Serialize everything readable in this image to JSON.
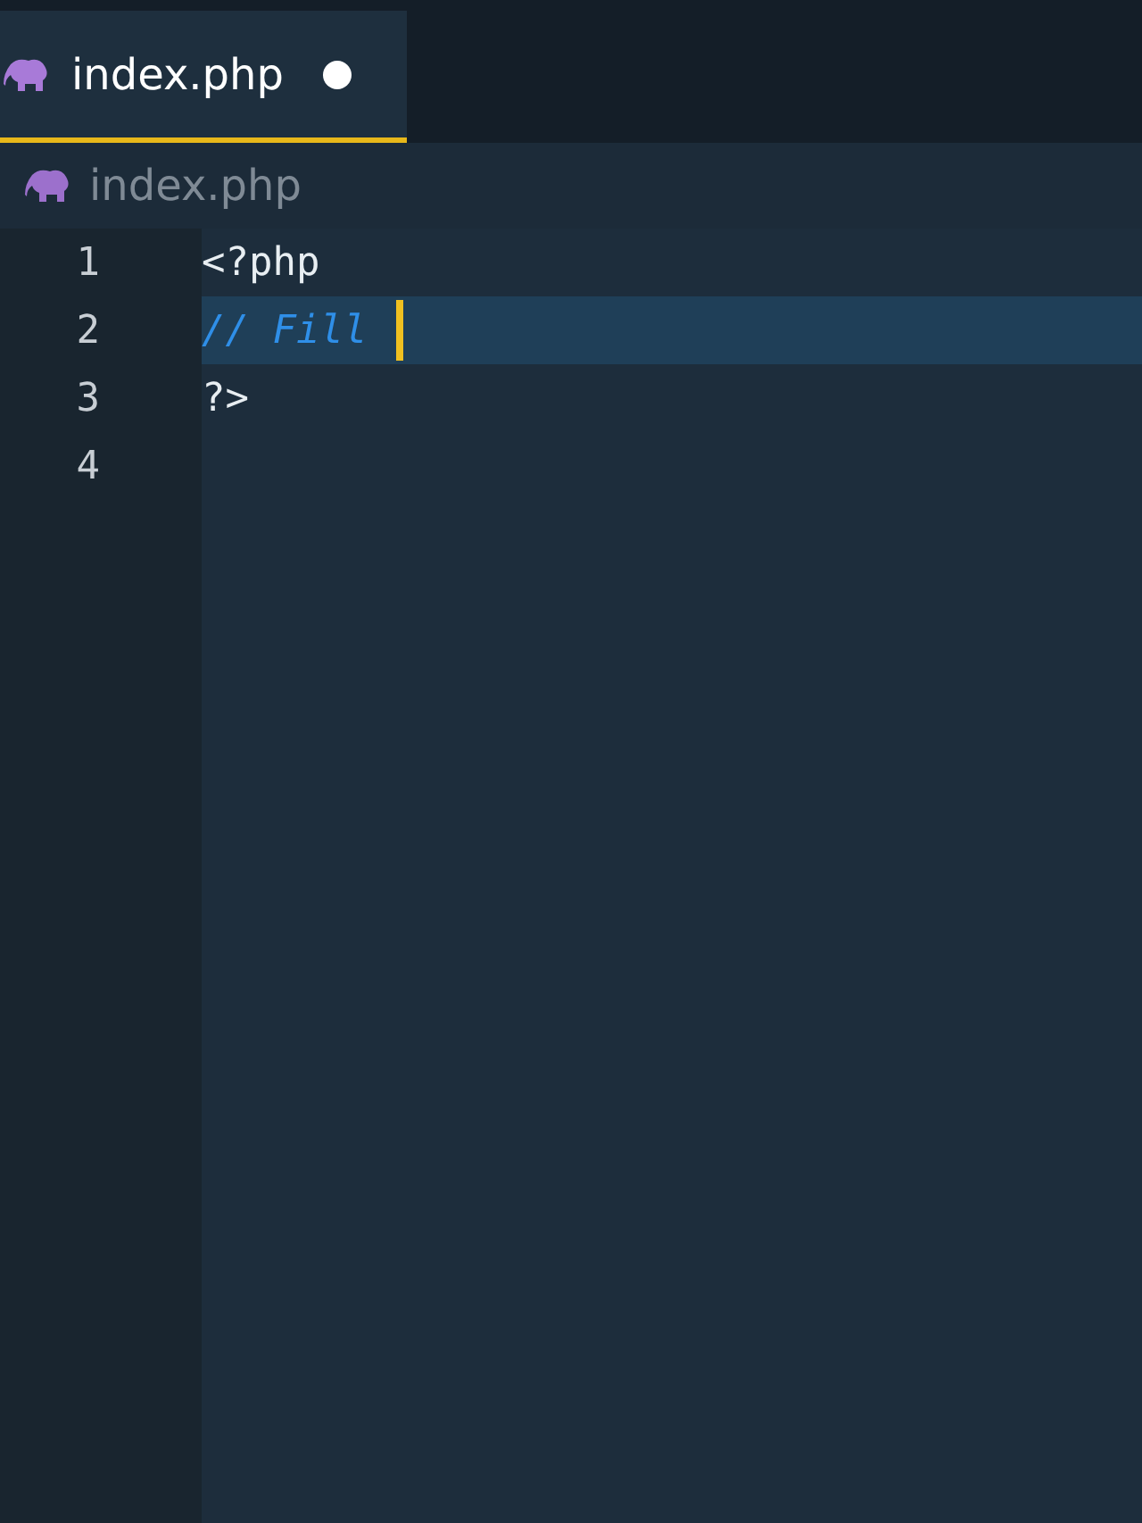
{
  "tabs": [
    {
      "label": "index.php",
      "selected": true,
      "modified": true
    }
  ],
  "breadcrumb": {
    "label": "index.php"
  },
  "lines": [
    {
      "number": "1",
      "text": "<?php",
      "kind": "code"
    },
    {
      "number": "2",
      "text": "// Fill",
      "kind": "comment",
      "current": true
    },
    {
      "number": "3",
      "text": "?>",
      "kind": "code"
    },
    {
      "number": "4"
    }
  ]
}
